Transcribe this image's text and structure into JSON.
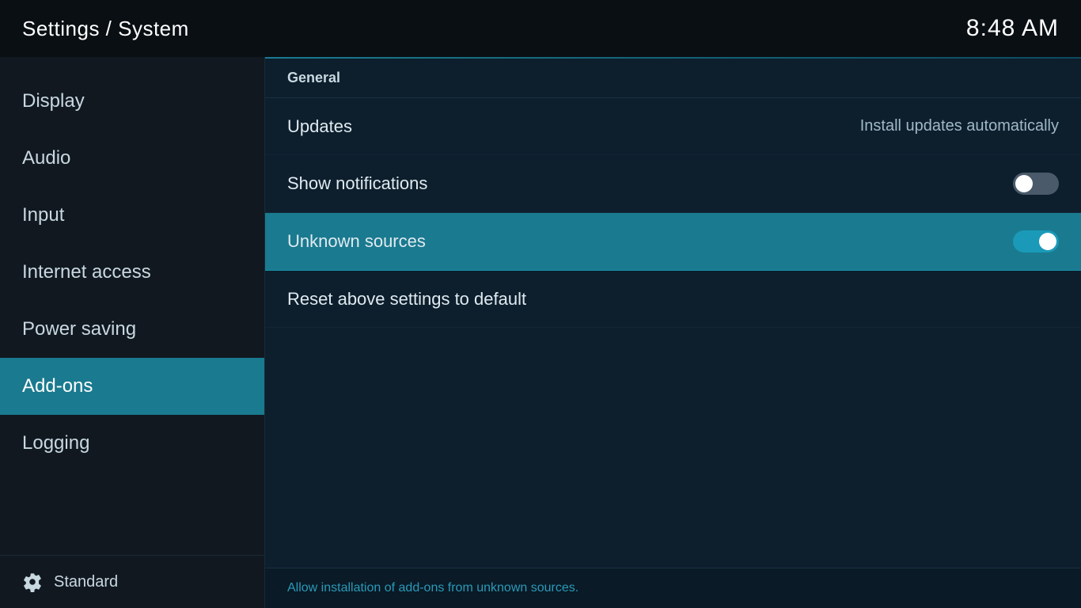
{
  "header": {
    "title": "Settings / System",
    "time": "8:48 AM"
  },
  "sidebar": {
    "items": [
      {
        "id": "display",
        "label": "Display",
        "active": false
      },
      {
        "id": "audio",
        "label": "Audio",
        "active": false
      },
      {
        "id": "input",
        "label": "Input",
        "active": false
      },
      {
        "id": "internet-access",
        "label": "Internet access",
        "active": false
      },
      {
        "id": "power-saving",
        "label": "Power saving",
        "active": false
      },
      {
        "id": "add-ons",
        "label": "Add-ons",
        "active": true
      },
      {
        "id": "logging",
        "label": "Logging",
        "active": false
      }
    ],
    "footer_label": "Standard"
  },
  "content": {
    "section_title": "General",
    "settings": [
      {
        "id": "updates",
        "label": "Updates",
        "value": "Install updates automatically",
        "toggle": null,
        "highlighted": false
      },
      {
        "id": "show-notifications",
        "label": "Show notifications",
        "value": null,
        "toggle": "off",
        "highlighted": false
      },
      {
        "id": "unknown-sources",
        "label": "Unknown sources",
        "value": null,
        "toggle": "on",
        "highlighted": true
      },
      {
        "id": "reset-settings",
        "label": "Reset above settings to default",
        "value": null,
        "toggle": null,
        "highlighted": false
      }
    ],
    "bottom_description": "Allow installation of add-ons from unknown sources."
  }
}
